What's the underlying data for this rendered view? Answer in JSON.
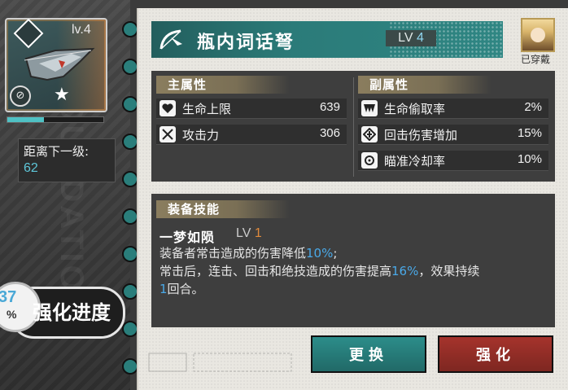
{
  "equipment": {
    "level_label": "lv.4",
    "next_level_label": "距离下一级:",
    "next_level_value": "62",
    "exp_fraction": 0.38,
    "watermark": "FOUNDATION"
  },
  "progress": {
    "percent": "37",
    "percent_sign": "%",
    "label": "强化进度"
  },
  "header": {
    "name": "瓶内词话弩",
    "lv_prefix": "LV",
    "lv_value": "4",
    "equipped_label": "已穿戴"
  },
  "main_attributes": {
    "title": "主属性",
    "items": [
      {
        "icon": "heart-icon",
        "name": "生命上限",
        "value": "639"
      },
      {
        "icon": "crossed-swords-icon",
        "name": "攻击力",
        "value": "306"
      }
    ]
  },
  "sub_attributes": {
    "title": "副属性",
    "items": [
      {
        "icon": "fang-icon",
        "name": "生命偷取率",
        "value": "2%"
      },
      {
        "icon": "counter-icon",
        "name": "回击伤害增加",
        "value": "15%"
      },
      {
        "icon": "crosshair-icon",
        "name": "瞄准冷却率",
        "value": "10%"
      }
    ]
  },
  "skill": {
    "title": "装备技能",
    "name": "一梦如陨",
    "lv_prefix": "LV",
    "lv_value": "1",
    "line1_a": "装备者常击造成的伤害降低",
    "line1_b": "10%",
    "line1_c": ";",
    "line2_a": "常击后，连击、回击和绝技造成的伤害提高",
    "line2_b": "16%",
    "line2_c": "，效果持续",
    "line3_a": "1",
    "line3_b": "回合。"
  },
  "buttons": {
    "change": "更换",
    "enhance": "强化"
  },
  "colors": {
    "teal": "#2b7b79",
    "red": "#a5332c",
    "highlight": "#4aa9e8"
  }
}
